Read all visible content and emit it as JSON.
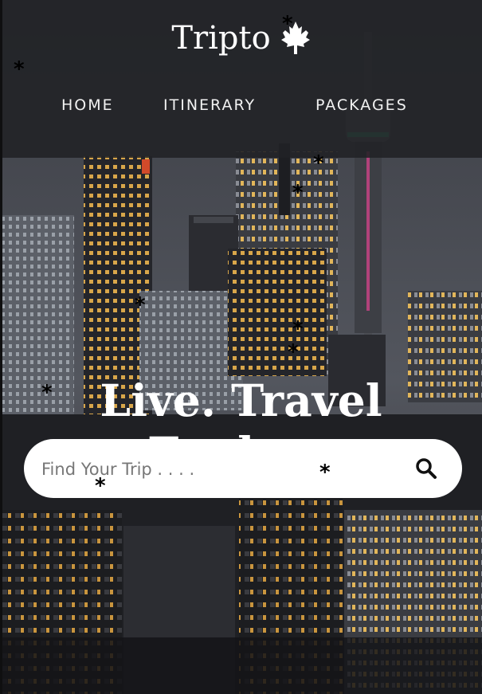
{
  "header": {
    "brand_name": "Tripto",
    "brand_icon": "maple-leaf-icon",
    "nav": [
      "HOME",
      "ITINERARY",
      "PACKAGES"
    ]
  },
  "hero": {
    "title": "Live. Travel Explore",
    "search": {
      "placeholder": "Find Your Trip . . . .",
      "value": "",
      "button_icon": "search-icon"
    }
  },
  "decor": {
    "asterisk": "*"
  },
  "colors": {
    "header_bg": "#212226",
    "text": "#ffffff",
    "search_bg": "#ffffff",
    "asterisk": "#000000"
  }
}
